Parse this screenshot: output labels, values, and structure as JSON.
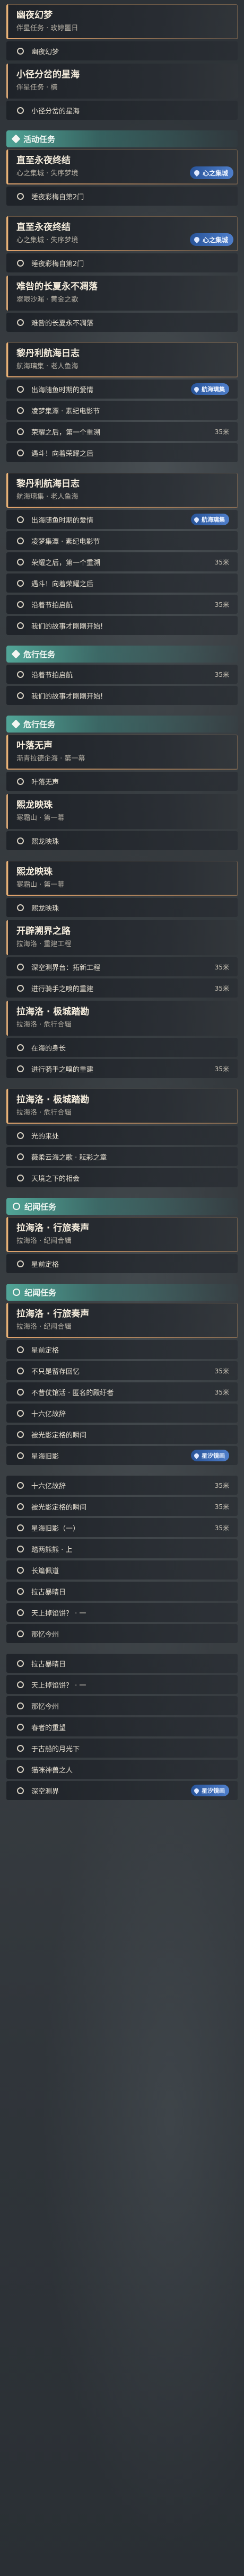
{
  "theme": {
    "card_accent": "#d6a574",
    "category_accent": "#5ac8b4",
    "location_badge": "#4f82d2",
    "objective_icon": "circle-outline-icon",
    "category_icon": "diamond-icon",
    "location_icon": "map-pin-icon"
  },
  "g1": {
    "q1": {
      "title": "幽夜幻梦",
      "sub": "伴星任务 · 玫婷噩日"
    },
    "o1": "幽夜幻梦",
    "q2": {
      "title": "小径分岔的星海",
      "sub": "伴星任务 · 楠"
    },
    "o2": "小径分岔的星海"
  },
  "g2": {
    "cat": "活动任务",
    "q1": {
      "title": "直至永夜终结",
      "sub": "心之集城 · 失序梦境",
      "badge": "心之集城"
    },
    "o1": "睡夜彩梅自第2门"
  },
  "g3": {
    "q1": {
      "title": "直至永夜终结",
      "sub": "心之集城 · 失序梦境",
      "badge": "心之集城"
    },
    "o1": "睡夜彩梅自第2门",
    "q2": {
      "title": "难咎的长夏永不凋落",
      "sub": "翠眼沙漏 · 黄金之歌"
    },
    "o2": "难咎的长夏永不凋落"
  },
  "g4": {
    "q1": {
      "title": "黎丹利航海日志",
      "sub": "航海璃集 · 老人鱼海"
    },
    "o1": {
      "text": "出海随鱼时期的爱情",
      "badge": "航海璃集"
    },
    "o2": "凌梦集潭 · 素纪电影节",
    "o3": {
      "text": "荣耀之后，第一个重溯",
      "dist": "35米"
    },
    "o4": "遇斗！向着荣耀之后"
  },
  "g5": {
    "q1": {
      "title": "黎丹利航海日志",
      "sub": "航海璃集 · 老人鱼海"
    },
    "o1": {
      "text": "出海随鱼时期的爱情",
      "badge": "航海璃集"
    },
    "o2": "凌梦集潭 · 素纪电影节",
    "o3": {
      "text": "荣耀之后，第一个重溯",
      "dist": "35米"
    },
    "o4": "遇斗！向着荣耀之后",
    "o5": {
      "text": "沿着节拍启航",
      "dist": "35米"
    },
    "o6": "我们的故事才刚刚开始!"
  },
  "g6": {
    "cat": "危行任务",
    "o1": {
      "text": "沿着节拍启航",
      "dist": "35米"
    },
    "o2": "我们的故事才刚刚开始!"
  },
  "g7": {
    "cat": "危行任务",
    "q1": {
      "title": "叶落无声",
      "sub": "渐青拉德企海 · 第一幕"
    },
    "o1": "叶落无声",
    "q2": {
      "title": "熙龙映珠",
      "sub": "寒霜山 · 第一幕"
    },
    "o2": "熙龙映珠"
  },
  "g8": {
    "q1": {
      "title": "熙龙映珠",
      "sub": "寒霜山 · 第一幕"
    },
    "o1": "熙龙映珠",
    "q2": {
      "title": "开辟溯界之路",
      "sub": "拉海洛 · 重建工程"
    },
    "o2": {
      "text": "深空测界台：拓新工程",
      "dist": "35米"
    },
    "o3": {
      "text": "进行骑手之嗅的重建",
      "dist": "35米"
    },
    "q3": {
      "title": "拉海洛 · 极城踏勘",
      "sub": "拉海洛 · 危行合辑"
    },
    "o4": "在海的身长",
    "o5": {
      "text": "进行骑手之嗅的重建",
      "dist": "35米"
    }
  },
  "g9": {
    "q1": {
      "title": "拉海洛 · 极城踏勘",
      "sub": "拉海洛 · 危行合辑"
    },
    "o1": "光的来处",
    "o2": "薇柔云海之歌 · 耘彩之章",
    "o3": "天境之下的相会"
  },
  "g10": {
    "cat": "纪闻任务",
    "q1": {
      "title": "拉海洛 · 行旅奏声",
      "sub": "拉海洛 · 纪闻合辑"
    },
    "o1": "星前定格"
  },
  "g11": {
    "cat": "纪闻任务",
    "q1": {
      "title": "拉海洛 · 行旅奏声",
      "sub": "拉海洛 · 纪闻合辑"
    },
    "o1": "星前定格",
    "o2": {
      "text": "不只是留存回忆",
      "dist": "35米"
    },
    "o3": {
      "text": "不昔仗馆活 · 匿名的殿纡者",
      "dist": "35米"
    },
    "o4": "十六亿故辞",
    "o5": "被光影定格的瞬间",
    "o6": {
      "text": "星海旧影",
      "badge": "星汐镜画"
    }
  },
  "g12": {
    "o1": {
      "text": "十六亿故辞",
      "dist": "35米"
    },
    "o2": {
      "text": "被光影定格的瞬间",
      "dist": "35米"
    },
    "o3": {
      "text": "星海旧影（一）",
      "dist": "35米"
    },
    "o4": "踏两熊熊 · 上",
    "o5": "长篇佩道",
    "o6": "拉古暴晴日",
    "o7": "天上掉馅饼？ · 一",
    "o8": "那忆今州"
  },
  "g13": {
    "o1": "拉古暴晴日",
    "o2": "天上掉馅饼？ · 一",
    "o3": "那忆今州",
    "o4": "春者的重望",
    "o5": "于古船的月光下",
    "o6": "猫咪神兽之人",
    "o7": {
      "text": "深空测界",
      "badge": "星汐镜画"
    }
  }
}
